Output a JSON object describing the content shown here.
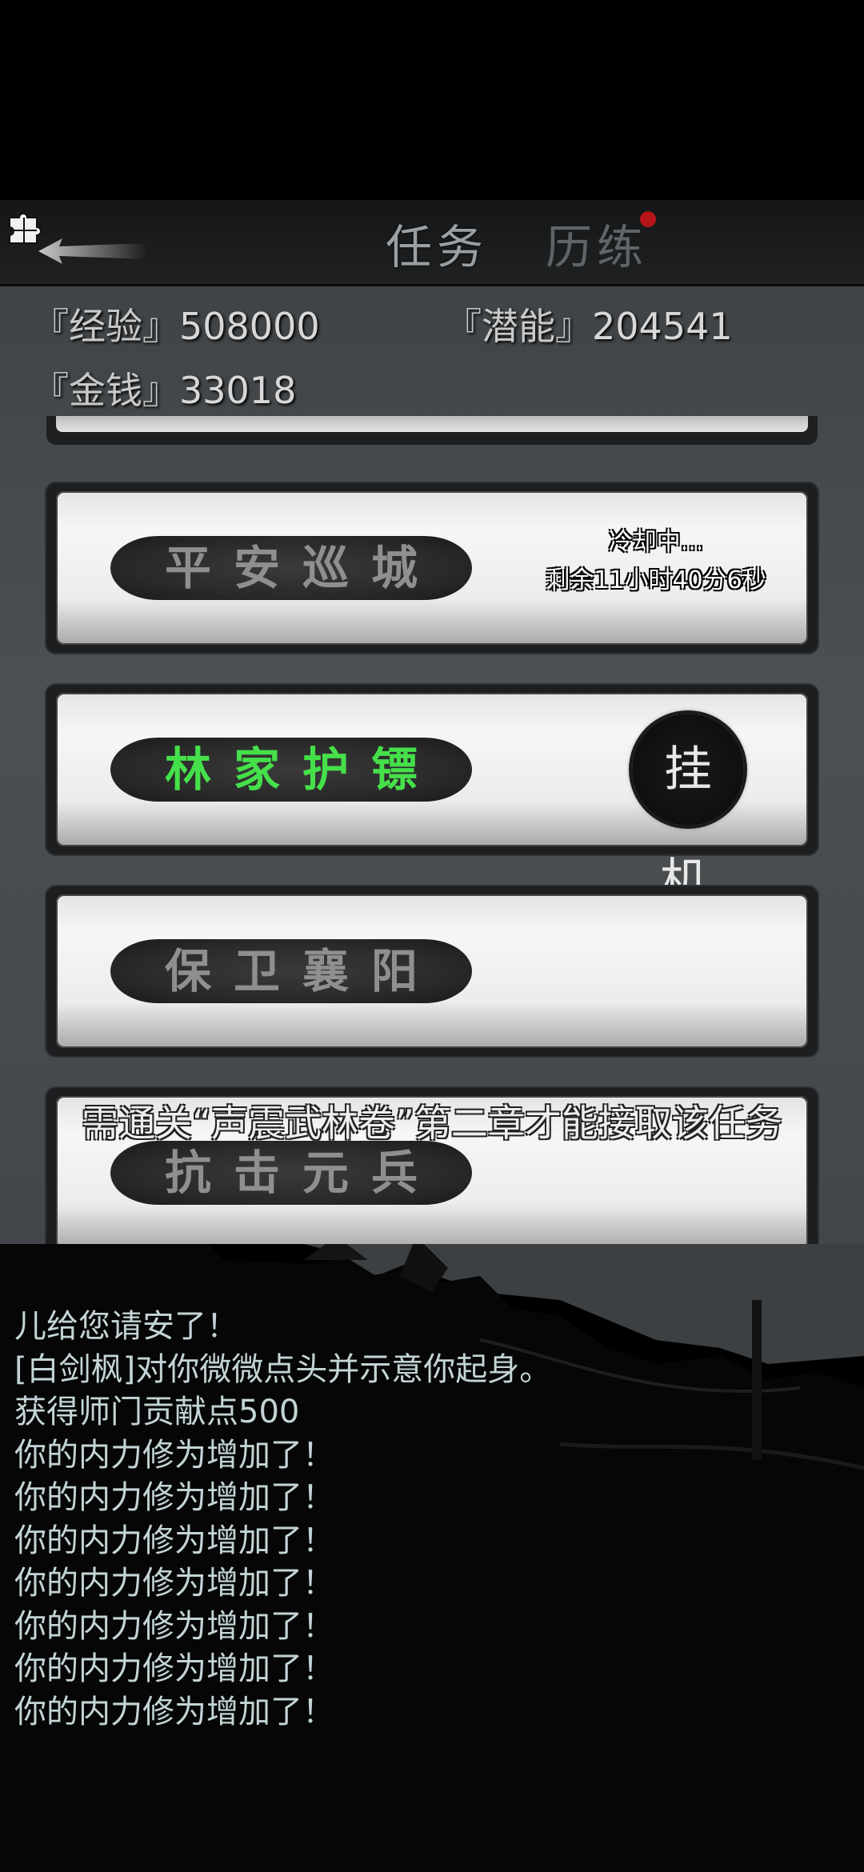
{
  "header": {
    "tabs": [
      {
        "label": "任务",
        "active": true
      },
      {
        "label": "历练",
        "active": false,
        "has_notification": true
      }
    ]
  },
  "stats": {
    "experience": {
      "label": "『经验』",
      "value": "508000"
    },
    "potential": {
      "label": "『潜能』",
      "value": "204541"
    },
    "money": {
      "label": "『金钱』",
      "value": "33018"
    }
  },
  "tasks": [
    {
      "title": "平安巡城",
      "status": "cooldown",
      "cooldown_line1": "冷却中...",
      "cooldown_line2": "剩余11小时40分6秒"
    },
    {
      "title": "林家护镖",
      "status": "active",
      "action_label": "挂机"
    },
    {
      "title": "保卫襄阳",
      "status": "available"
    },
    {
      "title": "抗击元兵",
      "status": "locked"
    }
  ],
  "notice": "需通关“声震武林卷”第二章才能接取该任务",
  "log": [
    "儿给您请安了！",
    "[白剑枫]对你微微点头并示意你起身。",
    "获得师门贡献点500",
    "你的内力修为增加了！",
    "你的内力修为增加了！",
    "你的内力修为增加了！",
    "你的内力修为增加了！",
    "你的内力修为增加了！",
    "你的内力修为增加了！",
    "你的内力修为增加了！"
  ],
  "colors": {
    "active_task_text": "#45e04a",
    "notification_dot": "#b4141a",
    "log_text": "#c3d4d6"
  }
}
